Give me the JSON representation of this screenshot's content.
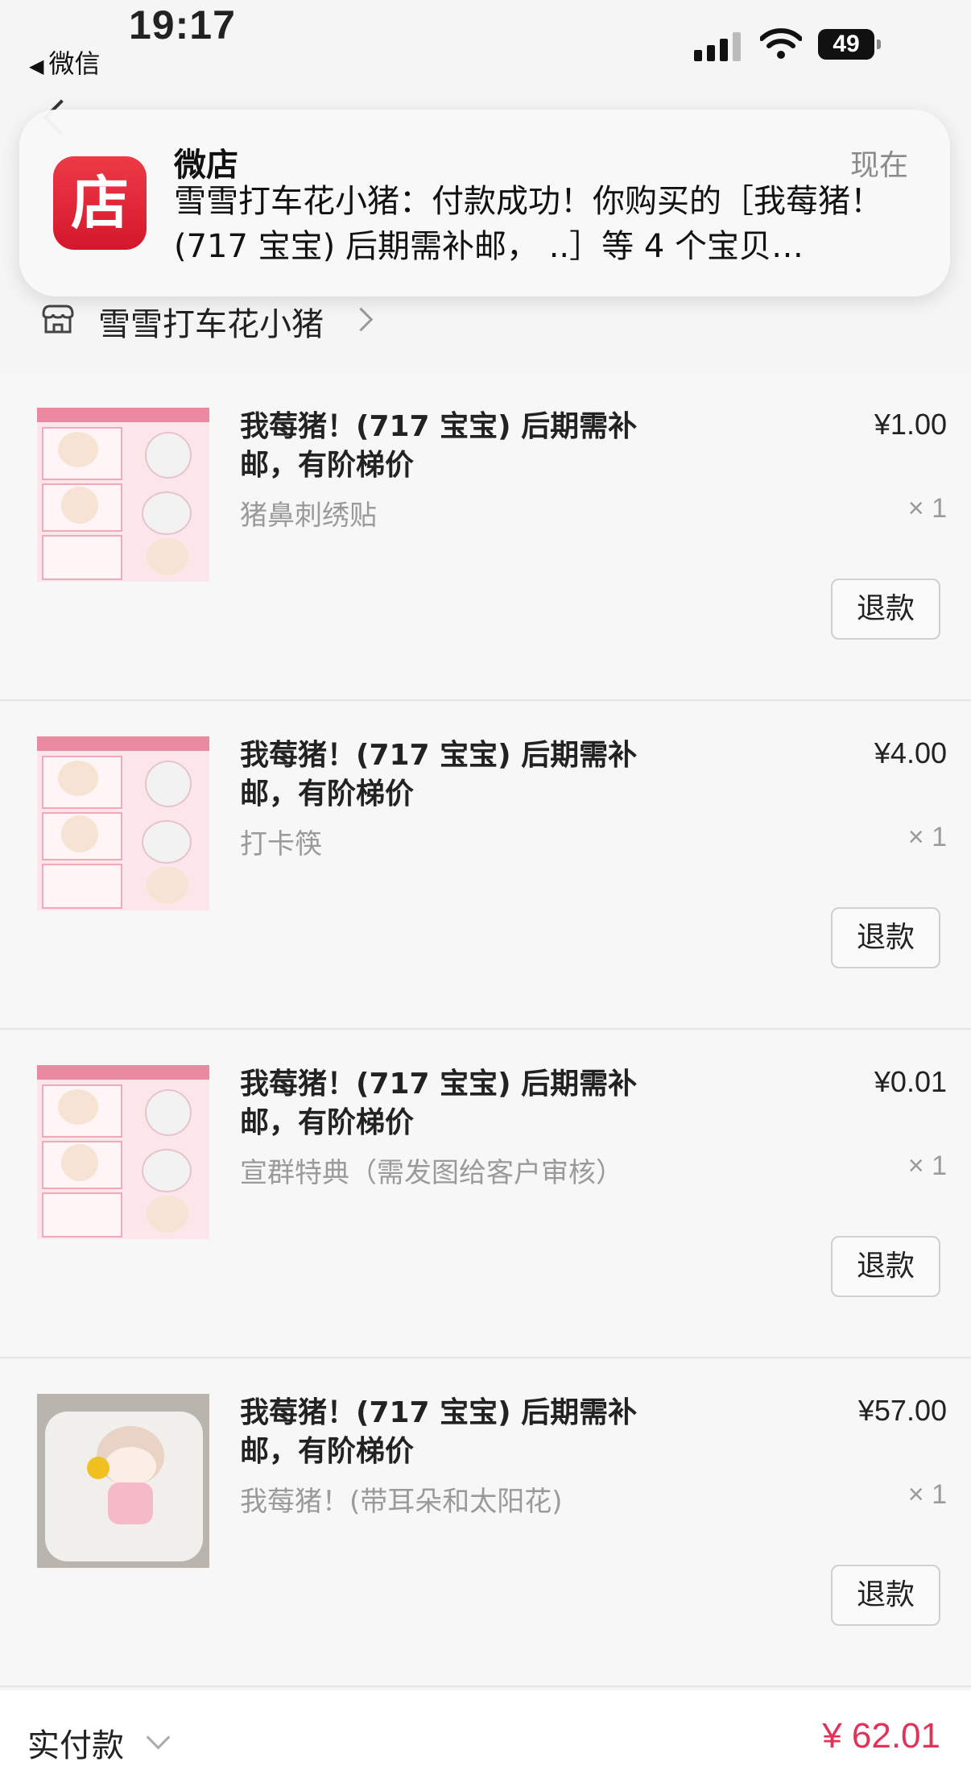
{
  "status_bar": {
    "time": "19:17",
    "back_app": "微信",
    "battery": "49"
  },
  "notification": {
    "app_name": "微店",
    "icon_glyph": "店",
    "time": "现在",
    "message": "雪雪打车花小猪：付款成功！你购买的［我莓猪！(717 宝宝) 后期需补邮， ..］等 4 个宝贝…",
    "accent": "#e0263a"
  },
  "shop": {
    "name": "雪雪打车花小猪"
  },
  "items": [
    {
      "title": "我莓猪！(717 宝宝) 后期需补邮，有阶梯价",
      "spec": "猪鼻刺绣贴",
      "price": "¥1.00",
      "qty": "× 1",
      "refund": "退款"
    },
    {
      "title": "我莓猪！(717 宝宝) 后期需补邮，有阶梯价",
      "spec": "打卡筷",
      "price": "¥4.00",
      "qty": "× 1",
      "refund": "退款"
    },
    {
      "title": "我莓猪！(717 宝宝) 后期需补邮，有阶梯价",
      "spec": "宣群特典（需发图给客户审核）",
      "price": "¥0.01",
      "qty": "× 1",
      "refund": "退款"
    },
    {
      "title": "我莓猪！(717 宝宝) 后期需补邮，有阶梯价",
      "spec": "我莓猪！(带耳朵和太阳花)",
      "price": "¥57.00",
      "qty": "× 1",
      "refund": "退款"
    }
  ],
  "footer": {
    "paid_label": "实付款",
    "total": "¥ 62.01",
    "total_color": "#e0335a"
  }
}
